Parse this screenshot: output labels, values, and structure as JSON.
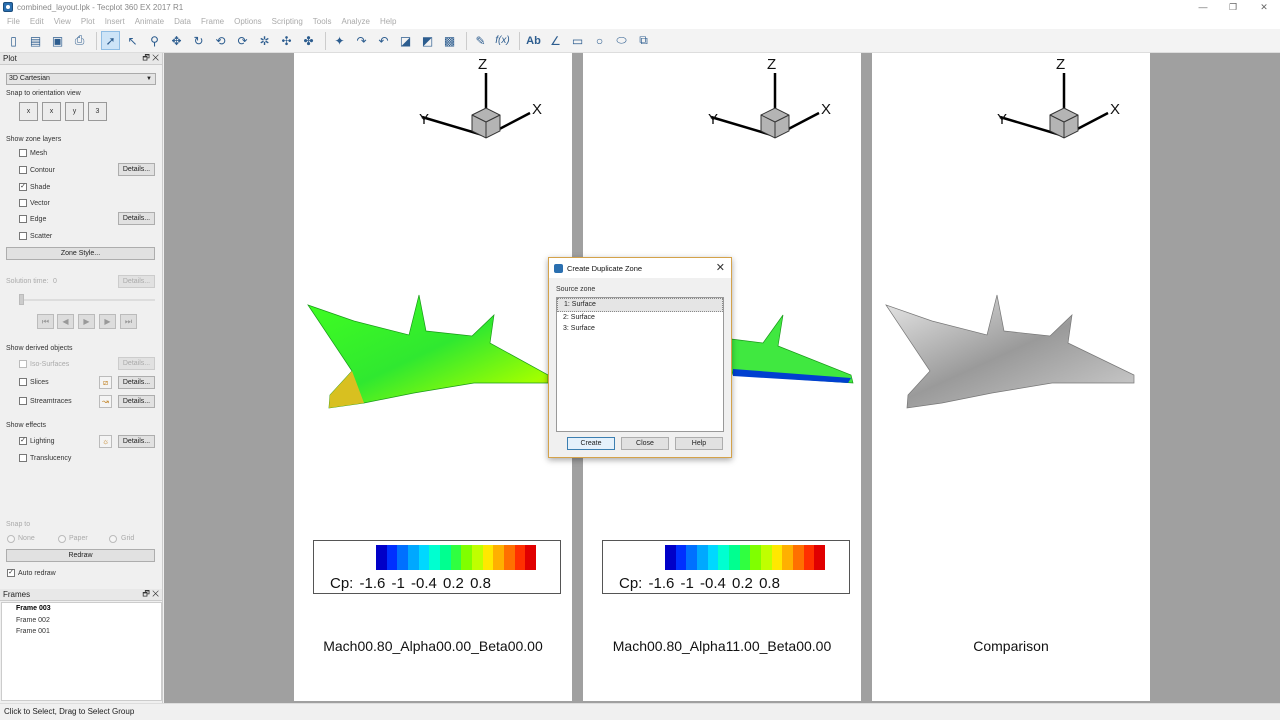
{
  "window": {
    "title": "combined_layout.lpk - Tecplot 360 EX 2017 R1",
    "minimize": "—",
    "restore": "❐",
    "close": "✕"
  },
  "menu": [
    "File",
    "Edit",
    "View",
    "Plot",
    "Insert",
    "Animate",
    "Data",
    "Frame",
    "Options",
    "Scripting",
    "Tools",
    "Analyze",
    "Help"
  ],
  "toolbar": {
    "fx": "f(x)",
    "text_tool": "Ab"
  },
  "plot_panel": {
    "header": "Plot",
    "plot_type": "3D Cartesian",
    "snap_orientation_label": "Snap to orientation view",
    "orientation_buttons": [
      "x",
      "x",
      "y",
      "3"
    ],
    "zone_layers_label": "Show zone layers",
    "layers": [
      {
        "label": "Mesh",
        "checked": false
      },
      {
        "label": "Contour",
        "checked": false,
        "details": "Details..."
      },
      {
        "label": "Shade",
        "checked": true
      },
      {
        "label": "Vector",
        "checked": false
      },
      {
        "label": "Edge",
        "checked": false,
        "details": "Details..."
      },
      {
        "label": "Scatter",
        "checked": false
      }
    ],
    "zone_style_button": "Zone Style...",
    "solution_time_label": "Solution time:",
    "solution_time_value": "0",
    "solution_details": "Details...",
    "derived_label": "Show derived objects",
    "derived": [
      {
        "label": "Iso-Surfaces",
        "checked": false,
        "details": "Details..."
      },
      {
        "label": "Slices",
        "checked": false,
        "details": "Details..."
      },
      {
        "label": "Streamtraces",
        "checked": false,
        "details": "Details..."
      }
    ],
    "effects_label": "Show effects",
    "effects": [
      {
        "label": "Lighting",
        "checked": true,
        "details": "Details..."
      },
      {
        "label": "Translucency",
        "checked": false
      }
    ],
    "snap_to_label": "Snap to",
    "snap_options": [
      "None",
      "Paper",
      "Grid"
    ],
    "redraw_button": "Redraw",
    "auto_redraw_label": "Auto redraw",
    "auto_redraw_checked": true
  },
  "frames_panel": {
    "header": "Frames",
    "items": [
      "Frame 003",
      "Frame 002",
      "Frame 001"
    ]
  },
  "frames": [
    {
      "title": "Mach00.80_Alpha00.00_Beta00.00",
      "legend": "Cp:  -1.6  -1  -0.4  0.2  0.8",
      "axes": [
        "X",
        "Y",
        "Z"
      ]
    },
    {
      "title": "Mach00.80_Alpha11.00_Beta00.00",
      "legend": "Cp:  -1.6  -1  -0.4  0.2  0.8",
      "axes": [
        "X",
        "Y",
        "Z"
      ]
    },
    {
      "title": "Comparison",
      "axes": [
        "X",
        "Y",
        "Z"
      ]
    }
  ],
  "colormap": [
    "#0000c8",
    "#0030ff",
    "#0070ff",
    "#00a8ff",
    "#00d8ff",
    "#00ffd0",
    "#00ff90",
    "#30ff40",
    "#80ff00",
    "#c0ff00",
    "#ffe800",
    "#ffb000",
    "#ff7000",
    "#ff3000",
    "#e00000"
  ],
  "dialog": {
    "title": "Create Duplicate Zone",
    "source_label": "Source zone",
    "zones": [
      "1: Surface",
      "2: Surface",
      "3: Surface"
    ],
    "buttons": {
      "create": "Create",
      "close": "Close",
      "help": "Help"
    }
  },
  "status": "Click to Select, Drag to Select Group"
}
